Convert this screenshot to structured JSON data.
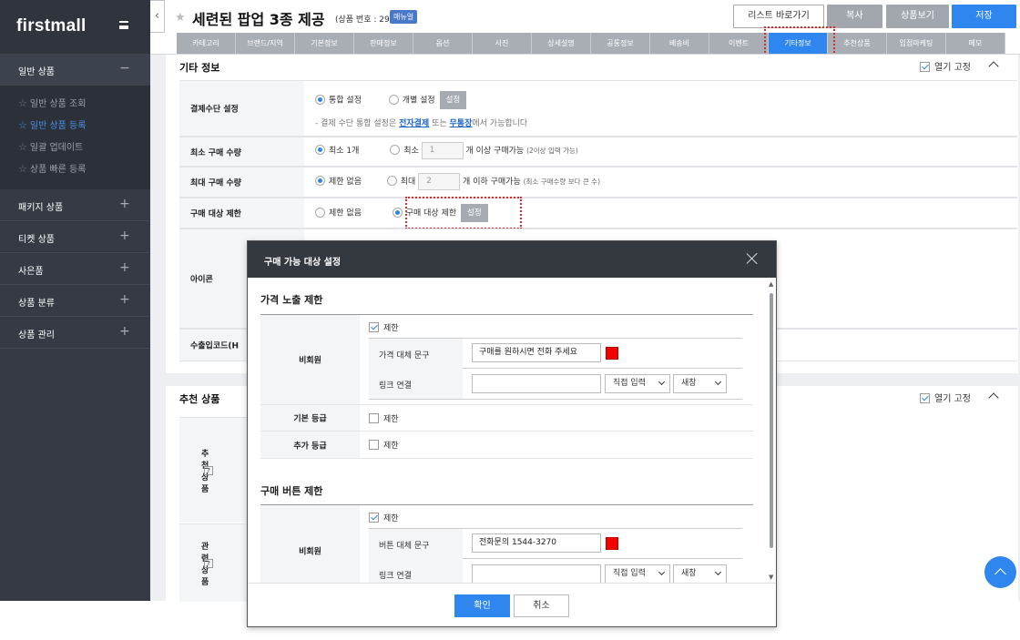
{
  "sidebar": {
    "logo": "firstmall",
    "menus": [
      {
        "label": "일반 상품",
        "sign": "−",
        "open": true,
        "items": [
          {
            "label": "일반 상품 조회"
          },
          {
            "label": "일반 상품 등록"
          },
          {
            "label": "일괄 업데이트"
          },
          {
            "label": "상품 빠른 등록"
          }
        ]
      },
      {
        "label": "패키지 상품",
        "sign": "+"
      },
      {
        "label": "티켓 상품",
        "sign": "+"
      },
      {
        "label": "사은품",
        "sign": "+"
      },
      {
        "label": "상품 분류",
        "sign": "+"
      },
      {
        "label": "상품 관리",
        "sign": "+"
      }
    ]
  },
  "header": {
    "collapse": "‹",
    "title": "세련된 팝업 3종 제공",
    "product_no": "(상품 번호 : 29)",
    "manual_badge": "매뉴얼",
    "buttons": {
      "list": "리스트 바로가기",
      "copy": "복사",
      "view": "상품보기",
      "save": "저장"
    },
    "tabs": [
      "카테고리",
      "브랜드/지역",
      "기본정보",
      "판매정보",
      "옵션",
      "사진",
      "상세설명",
      "공통정보",
      "배송비",
      "이벤트",
      "기타정보",
      "추천상품",
      "입점마케팅",
      "메모"
    ]
  },
  "etc_section": {
    "title": "기타 정보",
    "fix_label": "열기 고정",
    "payment": {
      "label": "결제수단 설정",
      "opt1": "통합 설정",
      "opt2": "개별 설정",
      "btn": "설정",
      "note_prefix": "- 결제 수단 통합 설정은",
      "link1": "전자결제",
      "note_mid": "또는",
      "link2": "무통장",
      "note_suffix": "에서 가능합니다"
    },
    "min_buy": {
      "label": "최소 구매 수량",
      "opt1": "최소 1개",
      "opt2": "최소",
      "value": "1",
      "text": "개 이상 구매가능",
      "hint": "(2이상 입력 가능)"
    },
    "max_buy": {
      "label": "최대 구매 수량",
      "opt1": "제한 없음",
      "opt2": "최대",
      "value": "2",
      "text": "개 이하 구매가능",
      "hint": "(최소 구매수량 보다 큰 수)"
    },
    "buy_target": {
      "label": "구매 대상 제한",
      "opt1": "제한 없음",
      "opt2": "구매 대상 제한",
      "btn": "설정"
    },
    "icon_label": "아이콘",
    "export_label": "수출입코드(H"
  },
  "rec_section": {
    "title": "추천 상품",
    "fix_label": "열기 고정",
    "rec_label": "추천 상품",
    "rel_label": "관련상품",
    "help": "?"
  },
  "modal": {
    "title": "구매 가능 대상 설정",
    "price": {
      "heading": "가격 노출 제한",
      "nonmember_label": "비회원",
      "limit_label": "제한",
      "replace_label": "가격 대체 문구",
      "replace_value": "구매를 원하시면 전화 주세요",
      "link_label": "링크 연결",
      "link_mode": "직접 입력",
      "target": "새창",
      "basic_label": "기본 등급",
      "extra_label": "추가 등급"
    },
    "button": {
      "heading": "구매 버튼 제한",
      "nonmember_label": "비회원",
      "limit_label": "제한",
      "replace_label": "버튼 대체 문구",
      "replace_value": "전화문의 1544-3270",
      "link_label": "링크 연결",
      "link_mode": "직접 입력",
      "target": "새창"
    },
    "ok": "확인",
    "cancel": "취소"
  },
  "colors": {
    "accent": "#2f86ee",
    "sidebar": "#353a44",
    "swatch": "#f10000",
    "highlight": "#d32f2f"
  }
}
